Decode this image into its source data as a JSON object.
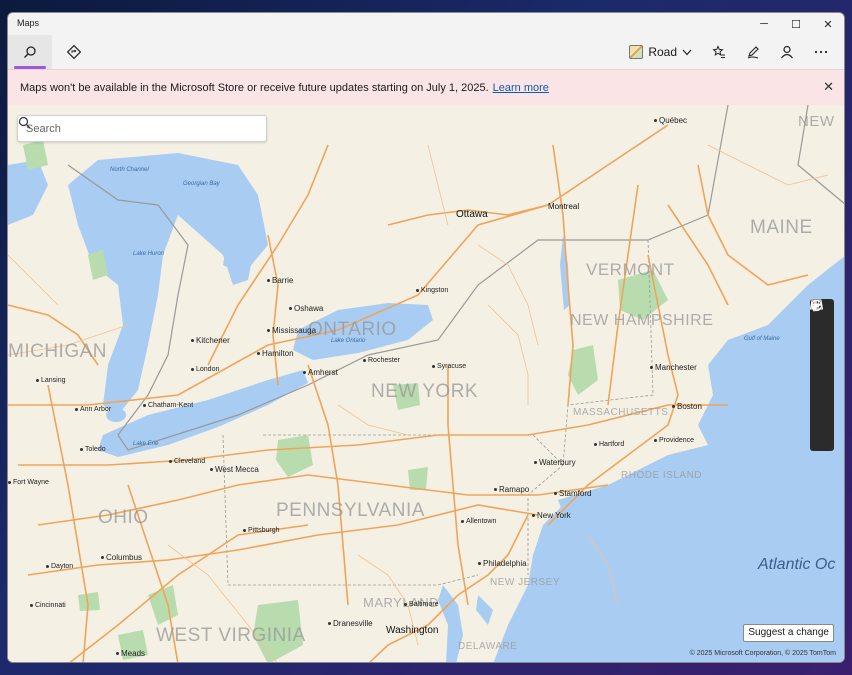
{
  "window": {
    "title": "Maps",
    "controls": {
      "minimize": "─",
      "maximize": "☐",
      "close": "✕"
    }
  },
  "toolbar": {
    "search_tab_icon": "search-icon",
    "directions_tab_icon": "directions-icon",
    "map_style_label": "Road",
    "favorites_icon": "favorites-icon",
    "ink_icon": "ink-pen-icon",
    "account_icon": "person-icon",
    "more_icon": "more-icon"
  },
  "banner": {
    "message": "Maps won't be available in the Microsoft Store or receive future updates starting on July 1, 2025.",
    "link": "Learn more"
  },
  "search": {
    "placeholder": "Search"
  },
  "map_controls": [
    "compass-icon",
    "grid-view-icon",
    "locate-me-icon",
    "zoom-in-icon",
    "zoom-out-icon"
  ],
  "labels": {
    "states": {
      "michigan": "MICHIGAN",
      "ontario": "ONTARIO",
      "new_york": "NEW YORK",
      "vermont": "VERMONT",
      "new_hampshire": "NEW HAMPSHIRE",
      "maine": "MAINE",
      "new": "NEW",
      "massachusetts": "MASSACHUSETTS",
      "rhode_island": "RHODE ISLAND",
      "ohio": "OHIO",
      "pennsylvania": "PENNSYLVANIA",
      "new_jersey": "NEW JERSEY",
      "maryland": "MARYLAND",
      "west_virginia": "WEST VIRGINIA",
      "delaware": "DELAWARE"
    },
    "cities": {
      "quebec": "Québec",
      "ottawa": "Ottawa",
      "montreal": "Montreal",
      "barrie": "Barrie",
      "oshawa": "Oshawa",
      "kingston": "Kingston",
      "kitchener": "Kitchener",
      "mississauga": "Mississauga",
      "hamilton": "Hamilton",
      "london": "London",
      "amherst": "Amherst",
      "rochester": "Rochester",
      "syracuse": "Syracuse",
      "lansing": "Lansing",
      "ann_arbor": "Ann Arbor",
      "chatham_kent": "Chatham-Kent",
      "toledo": "Toledo",
      "cleveland": "Cleveland",
      "west_mecca": "West Mecca",
      "fort_wayne": "Fort Wayne",
      "manchester": "Manchester",
      "boston": "Boston",
      "hartford": "Hartford",
      "providence": "Providence",
      "waterbury": "Waterbury",
      "ramapo": "Ramapo",
      "stamford": "Stamford",
      "new_york": "New York",
      "allentown": "Allentown",
      "pittsburgh": "Pittsburgh",
      "columbus": "Columbus",
      "dayton": "Dayton",
      "cincinnati": "Cincinnati",
      "philadelphia": "Philadelphia",
      "baltimore": "Baltimore",
      "dranesville": "Dranesville",
      "washington": "Washington",
      "meads": "Meads"
    },
    "water": {
      "north_channel": "North Channel",
      "georgian_bay": "Georgian Bay",
      "lake_huron": "Lake Huron",
      "lake_ontario": "Lake Ontario",
      "lake_erie": "Lake Erie",
      "gulf_of_maine": "Gulf of Maine",
      "atlantic": "Atlantic Oc"
    }
  },
  "suggest_change": "Suggest a change",
  "copyright": "© 2025 Microsoft Corporation, © 2025 TomTom",
  "colors": {
    "water": "#a9cdf2",
    "land": "#f4f0e4",
    "roads": "#f0a45a",
    "parks": "#b8dcae",
    "accent": "#9d5ad6"
  }
}
